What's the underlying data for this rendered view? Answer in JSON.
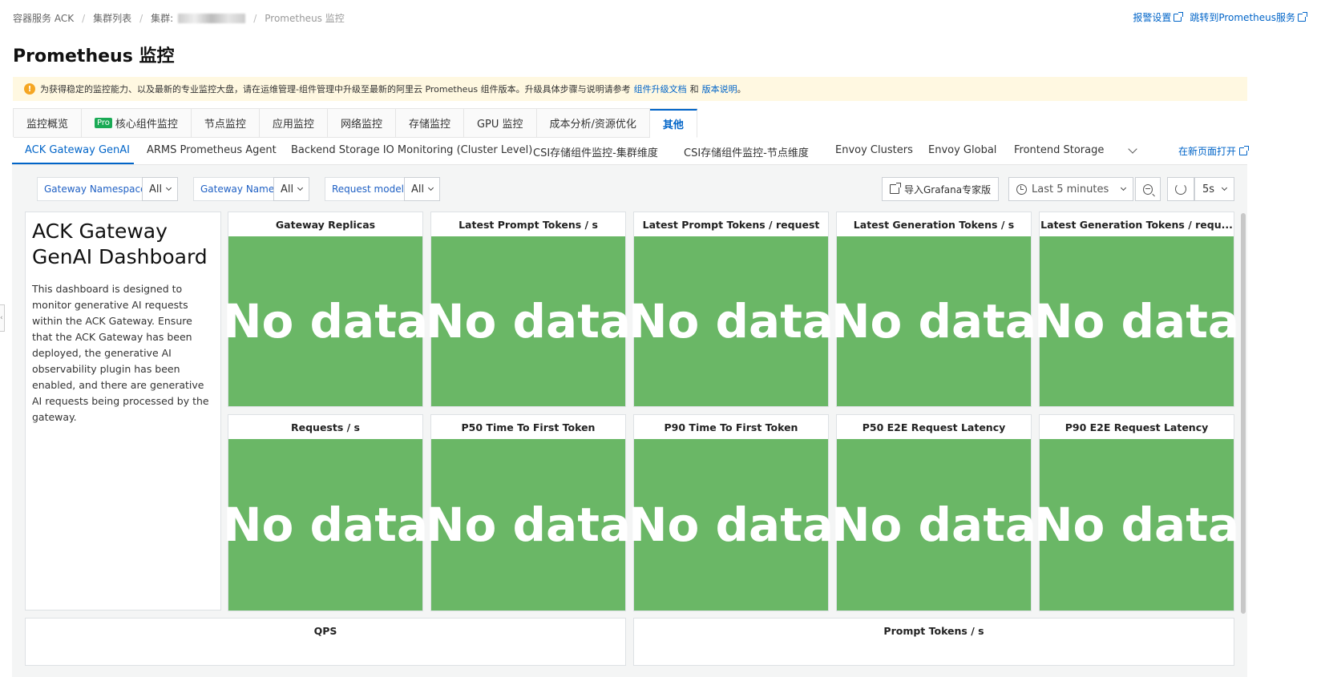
{
  "breadcrumb": {
    "items": [
      "容器服务 ACK",
      "集群列表",
      "集群:",
      "Prometheus 监控"
    ]
  },
  "toplinks": {
    "alert_settings": "报警设置",
    "goto_prometheus": "跳转到Prometheus服务"
  },
  "page_title": "Prometheus 监控",
  "alert": {
    "text": "为获得稳定的监控能力、以及最新的专业监控大盘，请在运维管理-组件管理中升级至最新的阿里云 Prometheus 组件版本。升级具体步骤与说明请参考",
    "link1": "组件升级文档",
    "and": "和",
    "link2": "版本说明",
    "end": "。"
  },
  "tabs": [
    {
      "label": "监控概览"
    },
    {
      "label": "核心组件监控",
      "badge": "Pro"
    },
    {
      "label": "节点监控"
    },
    {
      "label": "应用监控"
    },
    {
      "label": "网络监控"
    },
    {
      "label": "存储监控"
    },
    {
      "label": "GPU 监控"
    },
    {
      "label": "成本分析/资源优化"
    },
    {
      "label": "其他"
    }
  ],
  "subtabs": [
    "ACK Gateway GenAI",
    "ARMS Prometheus Agent",
    "Backend Storage IO Monitoring (Cluster Level)",
    "CSI存储组件监控-集群维度",
    "CSI存储组件监控-节点维度",
    "Envoy Clusters",
    "Envoy Global",
    "Frontend Storage"
  ],
  "open_new_page": "在新页面打开",
  "variables": {
    "ns_label": "Gateway Namespace",
    "ns_value": "All",
    "name_label": "Gateway Name",
    "name_value": "All",
    "model_label": "Request model",
    "model_value": "All"
  },
  "toolbar": {
    "import_grafana": "导入Grafana专家版",
    "time_range": "Last 5 minutes",
    "refresh_interval": "5s"
  },
  "text_panel": {
    "title": "ACK Gateway GenAI Dashboard",
    "body": "This dashboard is designed to monitor generative AI requests within the ACK Gateway. Ensure that the ACK Gateway has been deployed, the generative AI observability plugin has been enabled, and there are generative AI requests being processed by the gateway."
  },
  "stat_panels": [
    {
      "title": "Gateway Replicas",
      "value": "No data"
    },
    {
      "title": "Latest Prompt Tokens / s",
      "value": "No data"
    },
    {
      "title": "Latest Prompt Tokens / request",
      "value": "No data"
    },
    {
      "title": "Latest Generation Tokens / s",
      "value": "No data"
    },
    {
      "title": "Latest Generation Tokens / requ...",
      "value": "No data"
    },
    {
      "title": "Requests / s",
      "value": "No data"
    },
    {
      "title": "P50 Time To First Token",
      "value": "No data"
    },
    {
      "title": "P90 Time To First Token",
      "value": "No data"
    },
    {
      "title": "P50 E2E Request Latency",
      "value": "No data"
    },
    {
      "title": "P90 E2E Request Latency",
      "value": "No data"
    }
  ],
  "wide_panels": [
    {
      "title": "QPS"
    },
    {
      "title": "Prompt Tokens / s"
    }
  ],
  "colors": {
    "accent": "#0064c8",
    "stat_bg": "#6ab766",
    "alert_bg": "#fff8e1"
  }
}
